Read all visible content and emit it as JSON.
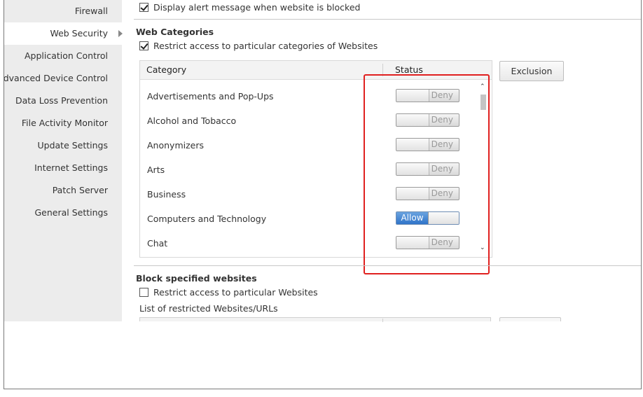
{
  "sidebar": {
    "items": [
      {
        "label": "Firewall",
        "active": false
      },
      {
        "label": "Web Security",
        "active": true
      },
      {
        "label": "Application Control",
        "active": false
      },
      {
        "label": "Advanced Device Control",
        "active": false
      },
      {
        "label": "Data Loss Prevention",
        "active": false
      },
      {
        "label": "File Activity Monitor",
        "active": false
      },
      {
        "label": "Update Settings",
        "active": false
      },
      {
        "label": "Internet Settings",
        "active": false
      },
      {
        "label": "Patch Server",
        "active": false
      },
      {
        "label": "General Settings",
        "active": false
      }
    ]
  },
  "alert": {
    "checked": true,
    "label": "Display alert message when website is blocked"
  },
  "web_categories": {
    "title": "Web Categories",
    "restrict": {
      "checked": true,
      "label": "Restrict access to particular categories of Websites"
    },
    "table": {
      "col_category": "Category",
      "col_status": "Status",
      "rows": [
        {
          "name": "Advertisements and Pop-Ups",
          "status": "Deny"
        },
        {
          "name": "Alcohol and Tobacco",
          "status": "Deny"
        },
        {
          "name": "Anonymizers",
          "status": "Deny"
        },
        {
          "name": "Arts",
          "status": "Deny"
        },
        {
          "name": "Business",
          "status": "Deny"
        },
        {
          "name": "Computers and Technology",
          "status": "Allow"
        },
        {
          "name": "Chat",
          "status": "Deny"
        }
      ]
    },
    "exclusion_button": "Exclusion"
  },
  "block_websites": {
    "title": "Block specified websites",
    "restrict": {
      "checked": false,
      "label": "Restrict access to particular Websites"
    },
    "list_label": "List of restricted Websites/URLs"
  },
  "colors": {
    "highlight_box": "#e0201f",
    "allow_toggle": "#2f74c9"
  },
  "icons": {
    "nav_arrow": "triangle-right",
    "scroll_up": "chevron-up",
    "scroll_down": "chevron-down"
  }
}
